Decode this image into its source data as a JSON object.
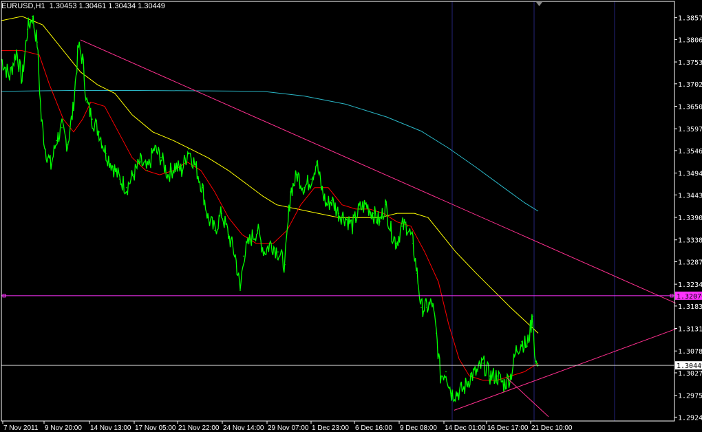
{
  "window": {
    "symbol": "EURUSD,H1",
    "ohlc": "1.30453 1.30461 1.30434 1.30449"
  },
  "colors": {
    "background": "#000000",
    "frame": "#ffffff",
    "price": "#00ff00",
    "ma_fast": "#ff0000",
    "ma_medium": "#ffff00",
    "ma_slow": "#2ab7c7",
    "trendline": "#ff2f8f",
    "hline": "#ff33ff",
    "vline": "#24247a"
  },
  "chart_data": {
    "type": "line",
    "y_ticks": [
      "1.38570",
      "1.38060",
      "1.37535",
      "1.37025",
      "1.36500",
      "1.35975",
      "1.35465",
      "1.34940",
      "1.34430",
      "1.33905",
      "1.33380",
      "1.32870",
      "1.32345",
      "1.31835",
      "1.31310",
      "1.30785",
      "1.30275",
      "1.29750",
      "1.29240"
    ],
    "x_ticks": [
      "7 Nov 2011",
      "9 Nov 20:00",
      "14 Nov 13:00",
      "17 Nov 05:00",
      "21 Nov 22:00",
      "24 Nov 14:00",
      "29 Nov 07:00",
      "1 Dec 23:00",
      "6 Dec 16:00",
      "9 Dec 08:00",
      "14 Dec 01:00",
      "16 Dec 17:00",
      "21 Dec 10:00"
    ],
    "ylim": [
      1.2915,
      1.3895
    ],
    "current_price_label": "1.30449",
    "hline_label": "1.32076",
    "hline_value": 1.32076,
    "current_price": 1.30449,
    "price_series": [
      {
        "x": 0,
        "y": 1.376
      },
      {
        "x": 12,
        "y": 1.372
      },
      {
        "x": 22,
        "y": 1.378
      },
      {
        "x": 30,
        "y": 1.371
      },
      {
        "x": 38,
        "y": 1.383
      },
      {
        "x": 45,
        "y": 1.386
      },
      {
        "x": 52,
        "y": 1.38
      },
      {
        "x": 58,
        "y": 1.362
      },
      {
        "x": 64,
        "y": 1.355
      },
      {
        "x": 72,
        "y": 1.351
      },
      {
        "x": 80,
        "y": 1.357
      },
      {
        "x": 88,
        "y": 1.36
      },
      {
        "x": 96,
        "y": 1.356
      },
      {
        "x": 104,
        "y": 1.364
      },
      {
        "x": 112,
        "y": 1.379
      },
      {
        "x": 118,
        "y": 1.376
      },
      {
        "x": 124,
        "y": 1.366
      },
      {
        "x": 132,
        "y": 1.362
      },
      {
        "x": 142,
        "y": 1.359
      },
      {
        "x": 152,
        "y": 1.354
      },
      {
        "x": 162,
        "y": 1.351
      },
      {
        "x": 172,
        "y": 1.348
      },
      {
        "x": 182,
        "y": 1.346
      },
      {
        "x": 192,
        "y": 1.349
      },
      {
        "x": 202,
        "y": 1.352
      },
      {
        "x": 212,
        "y": 1.35
      },
      {
        "x": 222,
        "y": 1.355
      },
      {
        "x": 232,
        "y": 1.353
      },
      {
        "x": 242,
        "y": 1.349
      },
      {
        "x": 252,
        "y": 1.351
      },
      {
        "x": 262,
        "y": 1.35
      },
      {
        "x": 272,
        "y": 1.355
      },
      {
        "x": 282,
        "y": 1.351
      },
      {
        "x": 292,
        "y": 1.346
      },
      {
        "x": 300,
        "y": 1.339
      },
      {
        "x": 310,
        "y": 1.336
      },
      {
        "x": 320,
        "y": 1.34
      },
      {
        "x": 330,
        "y": 1.335
      },
      {
        "x": 340,
        "y": 1.33
      },
      {
        "x": 347,
        "y": 1.322
      },
      {
        "x": 352,
        "y": 1.33
      },
      {
        "x": 362,
        "y": 1.334
      },
      {
        "x": 372,
        "y": 1.336
      },
      {
        "x": 382,
        "y": 1.331
      },
      {
        "x": 392,
        "y": 1.333
      },
      {
        "x": 402,
        "y": 1.331
      },
      {
        "x": 412,
        "y": 1.328
      },
      {
        "x": 420,
        "y": 1.345
      },
      {
        "x": 430,
        "y": 1.349
      },
      {
        "x": 440,
        "y": 1.346
      },
      {
        "x": 450,
        "y": 1.348
      },
      {
        "x": 458,
        "y": 1.352
      },
      {
        "x": 465,
        "y": 1.346
      },
      {
        "x": 472,
        "y": 1.342
      },
      {
        "x": 480,
        "y": 1.343
      },
      {
        "x": 490,
        "y": 1.34
      },
      {
        "x": 500,
        "y": 1.339
      },
      {
        "x": 510,
        "y": 1.337
      },
      {
        "x": 520,
        "y": 1.341
      },
      {
        "x": 530,
        "y": 1.342
      },
      {
        "x": 540,
        "y": 1.34
      },
      {
        "x": 550,
        "y": 1.338
      },
      {
        "x": 558,
        "y": 1.342
      },
      {
        "x": 566,
        "y": 1.336
      },
      {
        "x": 574,
        "y": 1.333
      },
      {
        "x": 582,
        "y": 1.337
      },
      {
        "x": 590,
        "y": 1.337
      },
      {
        "x": 598,
        "y": 1.333
      },
      {
        "x": 604,
        "y": 1.326
      },
      {
        "x": 610,
        "y": 1.318
      },
      {
        "x": 618,
        "y": 1.318
      },
      {
        "x": 626,
        "y": 1.319
      },
      {
        "x": 632,
        "y": 1.312
      },
      {
        "x": 638,
        "y": 1.302
      },
      {
        "x": 646,
        "y": 1.303
      },
      {
        "x": 654,
        "y": 1.298
      },
      {
        "x": 662,
        "y": 1.298
      },
      {
        "x": 672,
        "y": 1.299
      },
      {
        "x": 682,
        "y": 1.302
      },
      {
        "x": 692,
        "y": 1.303
      },
      {
        "x": 700,
        "y": 1.305
      },
      {
        "x": 710,
        "y": 1.302
      },
      {
        "x": 720,
        "y": 1.302
      },
      {
        "x": 730,
        "y": 1.3
      },
      {
        "x": 740,
        "y": 1.302
      },
      {
        "x": 748,
        "y": 1.308
      },
      {
        "x": 756,
        "y": 1.31
      },
      {
        "x": 764,
        "y": 1.309
      },
      {
        "x": 772,
        "y": 1.316
      },
      {
        "x": 776,
        "y": 1.305
      },
      {
        "x": 780,
        "y": 1.3045
      }
    ],
    "ma_fast": [
      {
        "x": 0,
        "y": 1.378
      },
      {
        "x": 30,
        "y": 1.378
      },
      {
        "x": 55,
        "y": 1.377
      },
      {
        "x": 70,
        "y": 1.37
      },
      {
        "x": 90,
        "y": 1.362
      },
      {
        "x": 105,
        "y": 1.359
      },
      {
        "x": 118,
        "y": 1.362
      },
      {
        "x": 130,
        "y": 1.366
      },
      {
        "x": 150,
        "y": 1.365
      },
      {
        "x": 170,
        "y": 1.359
      },
      {
        "x": 190,
        "y": 1.353
      },
      {
        "x": 210,
        "y": 1.35
      },
      {
        "x": 230,
        "y": 1.349
      },
      {
        "x": 250,
        "y": 1.35
      },
      {
        "x": 270,
        "y": 1.352
      },
      {
        "x": 290,
        "y": 1.35
      },
      {
        "x": 310,
        "y": 1.345
      },
      {
        "x": 330,
        "y": 1.339
      },
      {
        "x": 350,
        "y": 1.335
      },
      {
        "x": 370,
        "y": 1.333
      },
      {
        "x": 395,
        "y": 1.333
      },
      {
        "x": 415,
        "y": 1.336
      },
      {
        "x": 435,
        "y": 1.342
      },
      {
        "x": 455,
        "y": 1.346
      },
      {
        "x": 475,
        "y": 1.346
      },
      {
        "x": 495,
        "y": 1.342
      },
      {
        "x": 515,
        "y": 1.341
      },
      {
        "x": 535,
        "y": 1.341
      },
      {
        "x": 555,
        "y": 1.34
      },
      {
        "x": 575,
        "y": 1.338
      },
      {
        "x": 595,
        "y": 1.337
      },
      {
        "x": 615,
        "y": 1.331
      },
      {
        "x": 635,
        "y": 1.324
      },
      {
        "x": 650,
        "y": 1.314
      },
      {
        "x": 665,
        "y": 1.306
      },
      {
        "x": 680,
        "y": 1.302
      },
      {
        "x": 700,
        "y": 1.301
      },
      {
        "x": 720,
        "y": 1.301
      },
      {
        "x": 740,
        "y": 1.302
      },
      {
        "x": 760,
        "y": 1.303
      },
      {
        "x": 780,
        "y": 1.305
      }
    ],
    "ma_medium": [
      {
        "x": 0,
        "y": 1.385
      },
      {
        "x": 30,
        "y": 1.386
      },
      {
        "x": 60,
        "y": 1.384
      },
      {
        "x": 90,
        "y": 1.378
      },
      {
        "x": 115,
        "y": 1.373
      },
      {
        "x": 140,
        "y": 1.37
      },
      {
        "x": 165,
        "y": 1.368
      },
      {
        "x": 190,
        "y": 1.363
      },
      {
        "x": 220,
        "y": 1.359
      },
      {
        "x": 250,
        "y": 1.357
      },
      {
        "x": 275,
        "y": 1.355
      },
      {
        "x": 300,
        "y": 1.353
      },
      {
        "x": 330,
        "y": 1.35
      },
      {
        "x": 355,
        "y": 1.347
      },
      {
        "x": 380,
        "y": 1.344
      },
      {
        "x": 400,
        "y": 1.342
      },
      {
        "x": 430,
        "y": 1.341
      },
      {
        "x": 460,
        "y": 1.34
      },
      {
        "x": 490,
        "y": 1.339
      },
      {
        "x": 520,
        "y": 1.339
      },
      {
        "x": 550,
        "y": 1.339
      },
      {
        "x": 575,
        "y": 1.34
      },
      {
        "x": 600,
        "y": 1.34
      },
      {
        "x": 620,
        "y": 1.339
      },
      {
        "x": 640,
        "y": 1.335
      },
      {
        "x": 660,
        "y": 1.331
      },
      {
        "x": 690,
        "y": 1.326
      },
      {
        "x": 715,
        "y": 1.322
      },
      {
        "x": 740,
        "y": 1.318
      },
      {
        "x": 760,
        "y": 1.315
      },
      {
        "x": 780,
        "y": 1.312
      }
    ],
    "ma_slow": [
      {
        "x": 0,
        "y": 1.3685
      },
      {
        "x": 100,
        "y": 1.3687
      },
      {
        "x": 200,
        "y": 1.3687
      },
      {
        "x": 300,
        "y": 1.3686
      },
      {
        "x": 380,
        "y": 1.3685
      },
      {
        "x": 440,
        "y": 1.3674
      },
      {
        "x": 500,
        "y": 1.3655
      },
      {
        "x": 560,
        "y": 1.3625
      },
      {
        "x": 610,
        "y": 1.3592
      },
      {
        "x": 650,
        "y": 1.3552
      },
      {
        "x": 690,
        "y": 1.3507
      },
      {
        "x": 730,
        "y": 1.346
      },
      {
        "x": 760,
        "y": 1.3425
      },
      {
        "x": 780,
        "y": 1.3405
      }
    ],
    "trendlines": [
      {
        "name": "",
        "points": [
          {
            "x": 115,
            "y": 1.3805
          },
          {
            "x": 980,
            "y": 1.319
          }
        ]
      },
      {
        "name": "",
        "points": [
          {
            "x": 658,
            "y": 1.294
          },
          {
            "x": 980,
            "y": 1.313
          }
        ]
      },
      {
        "name": "",
        "points": [
          {
            "x": 735,
            "y": 1.3015
          },
          {
            "x": 795,
            "y": 1.2925
          }
        ]
      }
    ],
    "vlines_x": [
      657,
      776,
      893
    ]
  }
}
